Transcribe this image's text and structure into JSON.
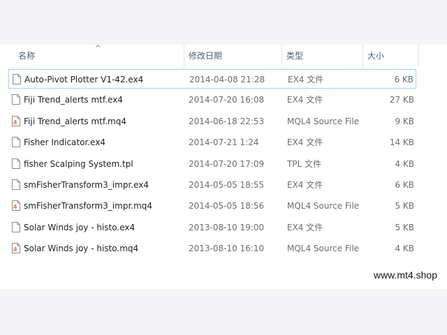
{
  "columns": {
    "name": "名称",
    "date": "修改日期",
    "type": "类型",
    "size": "大小"
  },
  "sort_indicator": "^",
  "files": [
    {
      "name": "Auto-Pivot Plotter  V1-42.ex4",
      "date": "2014-04-08 21:28",
      "type": "EX4 文件",
      "size": "6 KB",
      "icon": "blank-file-icon"
    },
    {
      "name": "Fiji Trend_alerts mtf.ex4",
      "date": "2014-07-20 16:08",
      "type": "EX4 文件",
      "size": "27 KB",
      "icon": "blank-file-icon"
    },
    {
      "name": "Fiji Trend_alerts mtf.mq4",
      "date": "2014-06-18 22:53",
      "type": "MQL4 Source File",
      "size": "9 KB",
      "icon": "mql4-file-icon"
    },
    {
      "name": "Fisher Indicator.ex4",
      "date": "2014-07-21 1:24",
      "type": "EX4 文件",
      "size": "14 KB",
      "icon": "blank-file-icon"
    },
    {
      "name": "fisher Scalping System.tpl",
      "date": "2014-07-20 17:09",
      "type": "TPL 文件",
      "size": "4 KB",
      "icon": "blank-file-icon"
    },
    {
      "name": "smFisherTransform3_impr.ex4",
      "date": "2014-05-05 18:55",
      "type": "EX4 文件",
      "size": "6 KB",
      "icon": "blank-file-icon"
    },
    {
      "name": "smFisherTransform3_impr.mq4",
      "date": "2014-05-05 18:56",
      "type": "MQL4 Source File",
      "size": "5 KB",
      "icon": "mql4-file-icon"
    },
    {
      "name": "Solar Winds joy - histo.ex4",
      "date": "2013-08-10 19:00",
      "type": "EX4 文件",
      "size": "5 KB",
      "icon": "blank-file-icon"
    },
    {
      "name": "Solar Winds joy - histo.mq4",
      "date": "2013-08-10 16:10",
      "type": "MQL4 Source File",
      "size": "4 KB",
      "icon": "mql4-file-icon"
    }
  ],
  "selected_index": 0,
  "watermark": "www.mt4.shop",
  "colors": {
    "header_text": "#4c607a",
    "selection_border": "#99d1ff",
    "mql4_icon": "#e8742c"
  }
}
